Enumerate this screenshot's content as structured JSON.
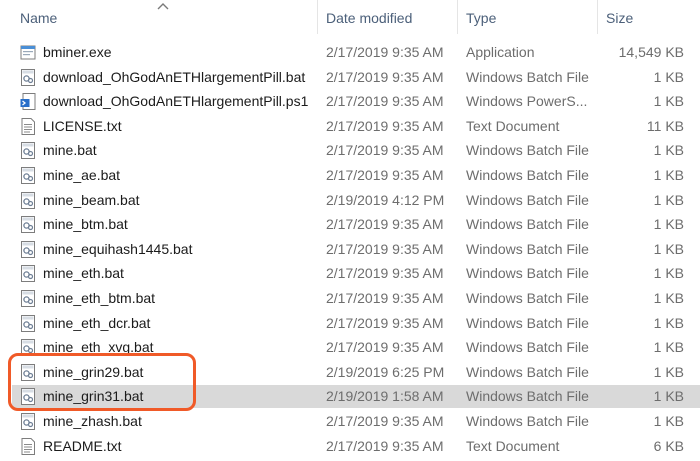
{
  "header": {
    "name": "Name",
    "date": "Date modified",
    "type": "Type",
    "size": "Size"
  },
  "files": [
    {
      "name": "bminer.exe",
      "date": "2/17/2019 9:35 AM",
      "type": "Application",
      "size": "14,549 KB",
      "icon": "exe-icon"
    },
    {
      "name": "download_OhGodAnETHlargementPill.bat",
      "date": "2/17/2019 9:35 AM",
      "type": "Windows Batch File",
      "size": "1 KB",
      "icon": "batch-file-icon"
    },
    {
      "name": "download_OhGodAnETHlargementPill.ps1",
      "date": "2/17/2019 9:35 AM",
      "type": "Windows PowerS...",
      "size": "1 KB",
      "icon": "powershell-file-icon"
    },
    {
      "name": "LICENSE.txt",
      "date": "2/17/2019 9:35 AM",
      "type": "Text Document",
      "size": "11 KB",
      "icon": "text-file-icon"
    },
    {
      "name": "mine.bat",
      "date": "2/17/2019 9:35 AM",
      "type": "Windows Batch File",
      "size": "1 KB",
      "icon": "batch-file-icon"
    },
    {
      "name": "mine_ae.bat",
      "date": "2/17/2019 9:35 AM",
      "type": "Windows Batch File",
      "size": "1 KB",
      "icon": "batch-file-icon"
    },
    {
      "name": "mine_beam.bat",
      "date": "2/19/2019 4:12 PM",
      "type": "Windows Batch File",
      "size": "1 KB",
      "icon": "batch-file-icon"
    },
    {
      "name": "mine_btm.bat",
      "date": "2/17/2019 9:35 AM",
      "type": "Windows Batch File",
      "size": "1 KB",
      "icon": "batch-file-icon"
    },
    {
      "name": "mine_equihash1445.bat",
      "date": "2/17/2019 9:35 AM",
      "type": "Windows Batch File",
      "size": "1 KB",
      "icon": "batch-file-icon"
    },
    {
      "name": "mine_eth.bat",
      "date": "2/17/2019 9:35 AM",
      "type": "Windows Batch File",
      "size": "1 KB",
      "icon": "batch-file-icon"
    },
    {
      "name": "mine_eth_btm.bat",
      "date": "2/17/2019 9:35 AM",
      "type": "Windows Batch File",
      "size": "1 KB",
      "icon": "batch-file-icon"
    },
    {
      "name": "mine_eth_dcr.bat",
      "date": "2/17/2019 9:35 AM",
      "type": "Windows Batch File",
      "size": "1 KB",
      "icon": "batch-file-icon"
    },
    {
      "name": "mine_eth_xvg.bat",
      "date": "2/17/2019 9:35 AM",
      "type": "Windows Batch File",
      "size": "1 KB",
      "icon": "batch-file-icon"
    },
    {
      "name": "mine_grin29.bat",
      "date": "2/19/2019 6:25 PM",
      "type": "Windows Batch File",
      "size": "1 KB",
      "icon": "batch-file-icon"
    },
    {
      "name": "mine_grin31.bat",
      "date": "2/19/2019 1:58 AM",
      "type": "Windows Batch File",
      "size": "1 KB",
      "icon": "batch-file-icon",
      "selected": true
    },
    {
      "name": "mine_zhash.bat",
      "date": "2/17/2019 9:35 AM",
      "type": "Windows Batch File",
      "size": "1 KB",
      "icon": "batch-file-icon"
    },
    {
      "name": "README.txt",
      "date": "2/17/2019 9:35 AM",
      "type": "Text Document",
      "size": "6 KB",
      "icon": "text-file-icon"
    }
  ],
  "colors": {
    "highlight_box": "#f05a28",
    "selected_row": "#d9d9d9",
    "header_text": "#4c607a"
  }
}
